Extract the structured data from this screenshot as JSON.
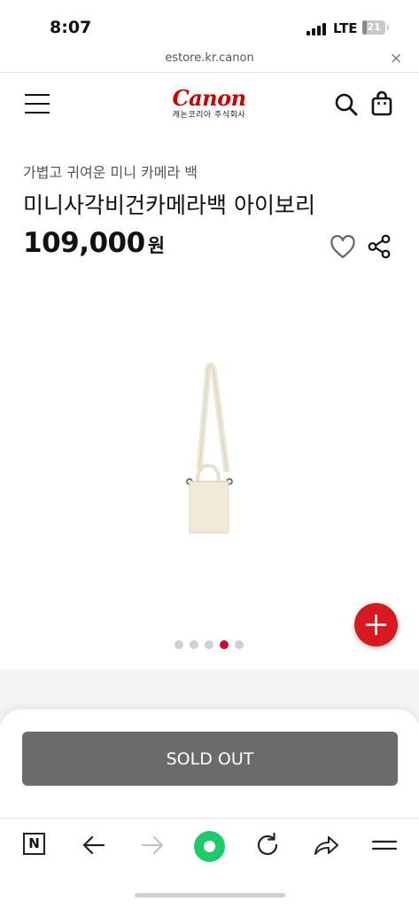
{
  "status_bar": {
    "time": "8:07",
    "network": "LTE",
    "battery_level": "21"
  },
  "browser": {
    "url": "estore.kr.canon",
    "close_symbol": "×"
  },
  "header": {
    "logo_text": "Canon",
    "logo_subtext": "캐논코리아 주식회사",
    "menu_icon": "hamburger-icon",
    "search_icon": "search-icon",
    "cart_icon": "shopping-bag-icon"
  },
  "product": {
    "subtitle": "가볍고 귀여운 미니 카메라 백",
    "name": "미니사각비건카메라백 아이보리",
    "price": "109,000",
    "currency": "원",
    "wishlist_icon": "heart-icon",
    "share_icon": "share-icon",
    "image": "ivory-mini-camera-bag",
    "gallery_total": 5,
    "gallery_active": 4
  },
  "actions": {
    "sold_out_label": "SOLD OUT",
    "fab_icon": "plus-icon"
  },
  "browser_toolbar": {
    "n_label": "N",
    "back_icon": "arrow-left-icon",
    "forward_icon": "arrow-right-icon",
    "home_icon": "green-circle-icon",
    "reload_icon": "reload-icon",
    "share_icon": "share-arrow-icon",
    "menu_icon": "menu-icon"
  },
  "colors": {
    "brand_red": "#cc0000",
    "fab_red": "#d71920",
    "dot_active": "#c8102e",
    "sold_out_gray": "#6b6b6b",
    "toolbar_green": "#1ecb6b"
  }
}
